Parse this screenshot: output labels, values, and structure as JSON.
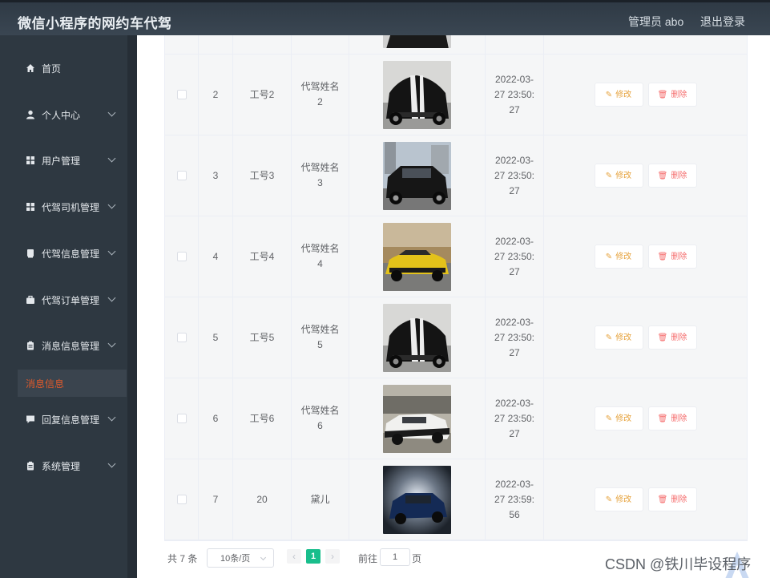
{
  "app": {
    "title": "微信小程序的网约车代驾"
  },
  "header": {
    "admin": "管理员 abo",
    "logout": "退出登录"
  },
  "sidebar": {
    "items": [
      {
        "label": "首页",
        "icon": "home-icon",
        "expandable": false
      },
      {
        "label": "个人中心",
        "icon": "user-icon",
        "expandable": true
      },
      {
        "label": "用户管理",
        "icon": "grid-icon",
        "expandable": true
      },
      {
        "label": "代驾司机管理",
        "icon": "grid-icon",
        "expandable": true
      },
      {
        "label": "代驾信息管理",
        "icon": "book-icon",
        "expandable": true
      },
      {
        "label": "代驾订单管理",
        "icon": "briefcase-icon",
        "expandable": true
      },
      {
        "label": "消息信息管理",
        "icon": "clipboard-icon",
        "expandable": true
      },
      {
        "label": "回复信息管理",
        "icon": "comment-icon",
        "expandable": true
      },
      {
        "label": "系统管理",
        "icon": "clipboard-icon",
        "expandable": true
      }
    ],
    "active_sub": "消息信息"
  },
  "table": {
    "rows": [
      {
        "index": "2",
        "no": "工号2",
        "name_line1": "代驾姓名",
        "name_line2": "2",
        "time_line1": "2022-03-",
        "time_line2": "27 23:50:",
        "time_line3": "27",
        "car": "black-muscle-car"
      },
      {
        "index": "3",
        "no": "工号3",
        "name_line1": "代驾姓名",
        "name_line2": "3",
        "time_line1": "2022-03-",
        "time_line2": "27 23:50:",
        "time_line3": "27",
        "car": "black-suv"
      },
      {
        "index": "4",
        "no": "工号4",
        "name_line1": "代驾姓名",
        "name_line2": "4",
        "time_line1": "2022-03-",
        "time_line2": "27 23:50:",
        "time_line3": "27",
        "car": "yellow-camaro"
      },
      {
        "index": "5",
        "no": "工号5",
        "name_line1": "代驾姓名",
        "name_line2": "5",
        "time_line1": "2022-03-",
        "time_line2": "27 23:50:",
        "time_line3": "27",
        "car": "black-muscle-car"
      },
      {
        "index": "6",
        "no": "工号6",
        "name_line1": "代驾姓名",
        "name_line2": "6",
        "time_line1": "2022-03-",
        "time_line2": "27 23:50:",
        "time_line3": "27",
        "car": "white-coupe"
      },
      {
        "index": "7",
        "no": "20",
        "name_line1": "黛儿",
        "name_line2": "",
        "time_line1": "2022-03-",
        "time_line2": "27 23:59:",
        "time_line3": "56",
        "car": "blue-suv"
      }
    ],
    "edit_label": "修改",
    "delete_label": "删除"
  },
  "pagination": {
    "total": "共 7 条",
    "page_size": "10条/页",
    "current": "1",
    "goto_label": "前往",
    "goto_value": "1",
    "page_label": "页"
  },
  "watermark": "CSDN @铁川毕设程序",
  "colors": {
    "accent": "#19be8c",
    "edit": "#e6a23c",
    "delete": "#f56c6c",
    "active_menu": "#e05a2b"
  }
}
